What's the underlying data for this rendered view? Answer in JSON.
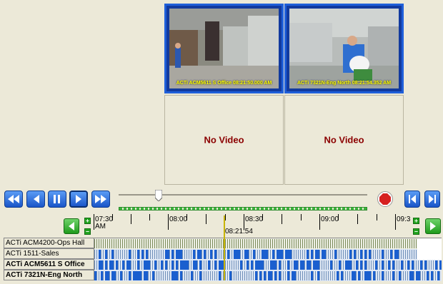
{
  "cameras": [
    {
      "name": "ACTi ACM5611 S Office",
      "osd": "ACTi ACM5611 S Office 08:21:50.000 AM",
      "state": "video",
      "selected": true
    },
    {
      "name": "ACTi 7321N-Eng North",
      "osd": "ACTi 7321N-Eng North 08:21:54.352 AM",
      "state": "video",
      "selected": true
    },
    {
      "name": "",
      "label": "No Video",
      "state": "no-video"
    },
    {
      "name": "",
      "label": "No Video",
      "state": "no-video"
    }
  ],
  "playback": {
    "buttons": [
      "rewind",
      "step-back",
      "pause",
      "play",
      "fast-forward",
      "record",
      "go-start",
      "go-end"
    ],
    "slider_position": 0.16,
    "record_color": "#d62020"
  },
  "timeline": {
    "ticks": [
      {
        "label": "07:30",
        "sub": "AM"
      },
      {
        "label": "08:00"
      },
      {
        "label": "08:30"
      },
      {
        "label": "09:00"
      },
      {
        "label": "09:3"
      }
    ],
    "cursor_time": "08:21:54",
    "rows": [
      {
        "name": "ACTi ACM4200-Ops Hall",
        "bold": false,
        "fill": 0.93,
        "style": "sparse"
      },
      {
        "name": "ACTi 1511-Sales",
        "bold": false,
        "fill": 0.93,
        "style": "dense"
      },
      {
        "name": "ACTi ACM5611 S Office",
        "bold": true,
        "fill": 1.0,
        "style": "dense"
      },
      {
        "name": "ACTi 7321N-Eng North",
        "bold": true,
        "fill": 1.0,
        "style": "dense"
      }
    ],
    "colors": {
      "accent": "#1f5fd9",
      "cursor": "#c8b400",
      "record_sparse": "#7a8a5a",
      "record_dense": "#1a5fcf"
    }
  }
}
